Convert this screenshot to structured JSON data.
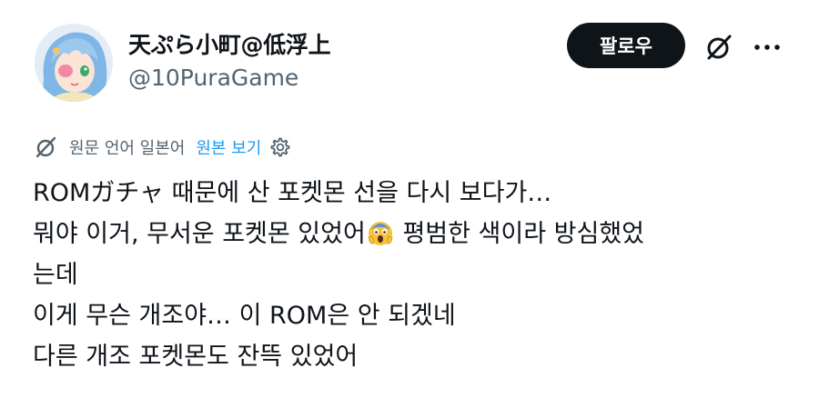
{
  "author": {
    "display_name": "天ぷら小町@低浮上",
    "handle": "@10PuraGame",
    "avatar_icon": "anime-avatar"
  },
  "header": {
    "follow_label": "팔로우",
    "grok_icon": "grok-icon",
    "more_icon": "more-dots-icon"
  },
  "translation": {
    "icon": "translate-icon",
    "note": "원문 언어 일본어",
    "show_original": "원본 보기",
    "settings_icon": "gear-icon",
    "link_color": "#1d9bf0"
  },
  "tweet": {
    "lines": [
      "ROMガチャ 때문에 산 포켓몬 선을 다시 보다가…",
      "뭐야 이거, 무서운 포켓몬 있었어",
      "평범한 색이라 방심했었",
      "는데",
      "이게 무슨 개조야… 이 ROM은 안 되겠네",
      "다른 개조 포켓몬도 잔뜩 있었어"
    ],
    "emoji": "screaming-face-emoji"
  }
}
